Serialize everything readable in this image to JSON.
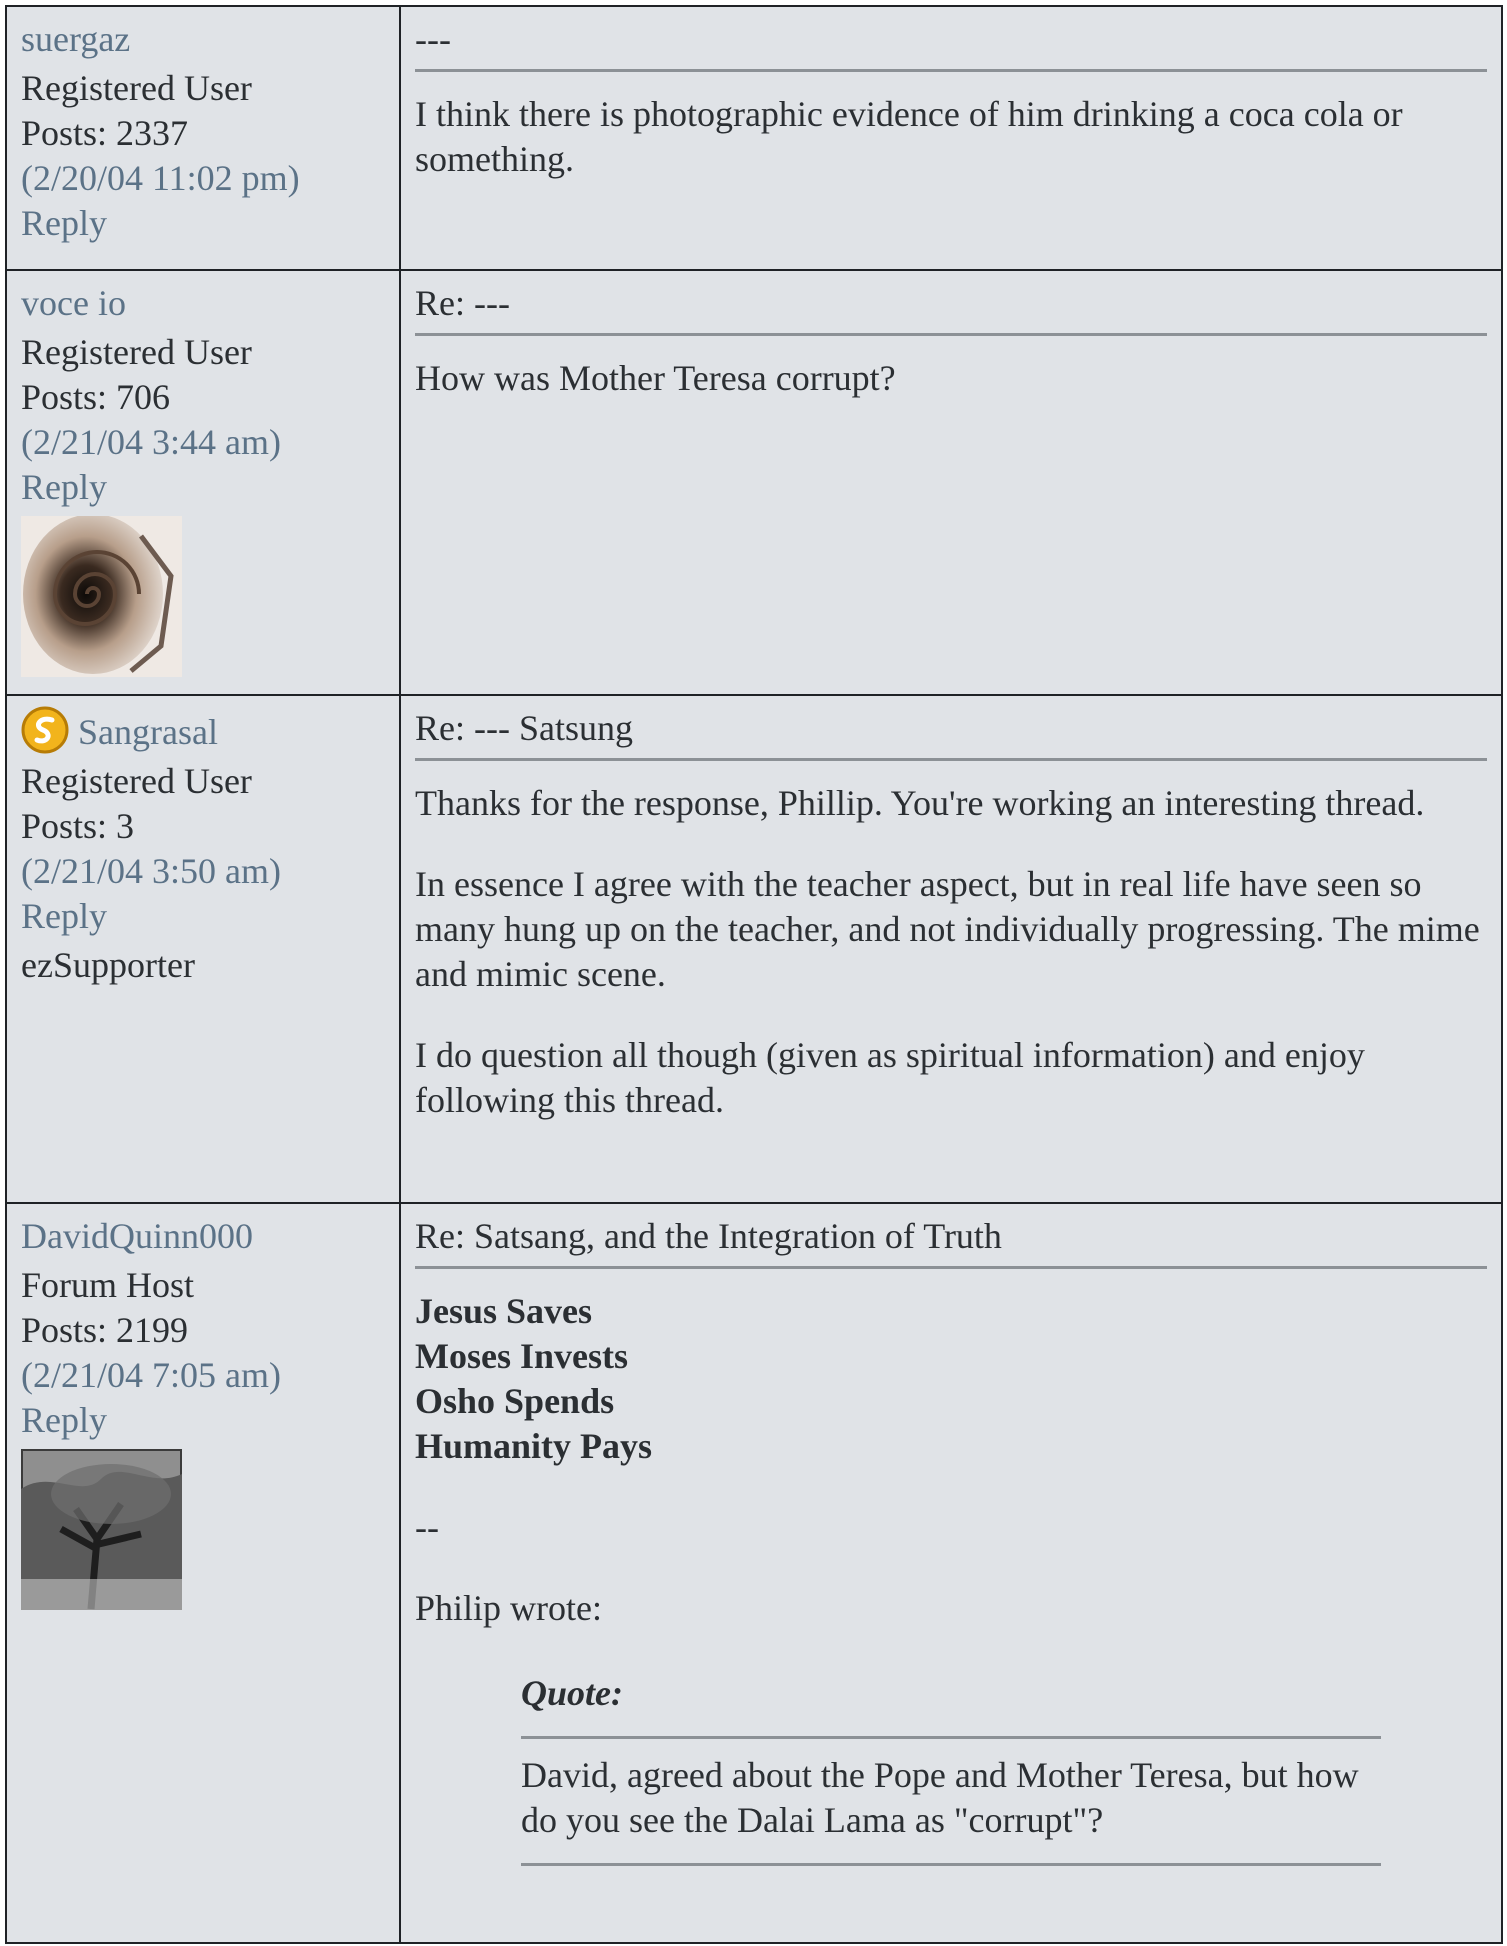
{
  "posts": [
    {
      "username": "suergaz",
      "role": "Registered User",
      "posts": "Posts: 2337",
      "date": "(2/20/04 11:02 pm)",
      "reply": "Reply",
      "subject": "---",
      "body": [
        "I think there is photographic evidence of him drinking a coca cola or something."
      ]
    },
    {
      "username": "voce io",
      "role": "Registered User",
      "posts": "Posts: 706",
      "date": "(2/21/04 3:44 am)",
      "reply": "Reply",
      "subject": "Re: ---",
      "body": [
        "How was Mother Teresa corrupt?"
      ]
    },
    {
      "username": "Sangrasal",
      "role": "Registered User",
      "posts": "Posts: 3",
      "date": "(2/21/04 3:50 am)",
      "reply": "Reply",
      "extra": "ezSupporter",
      "subject": "Re: --- Satsung",
      "body": [
        "Thanks for the response, Phillip. You're working an interesting thread.",
        "In essence I agree with the teacher aspect, but in real life have seen so many hung up on the teacher, and not individually progressing. The mime and mimic scene.",
        "I do question all though (given as spiritual information) and enjoy following this thread."
      ]
    },
    {
      "username": "DavidQuinn000",
      "role": "Forum Host",
      "posts": "Posts: 2199",
      "date": "(2/21/04 7:05 am)",
      "reply": "Reply",
      "subject": "Re: Satsang, and the Integration of Truth",
      "bold_lines": [
        "Jesus Saves",
        "Moses Invests",
        "Osho Spends",
        "Humanity Pays"
      ],
      "separator": "--",
      "wrote": "Philip wrote:",
      "quote_title": "Quote:",
      "quote_text": "David, agreed about the Pope and Mother Teresa, but how do you see the Dalai Lama as \"corrupt\"?"
    }
  ]
}
